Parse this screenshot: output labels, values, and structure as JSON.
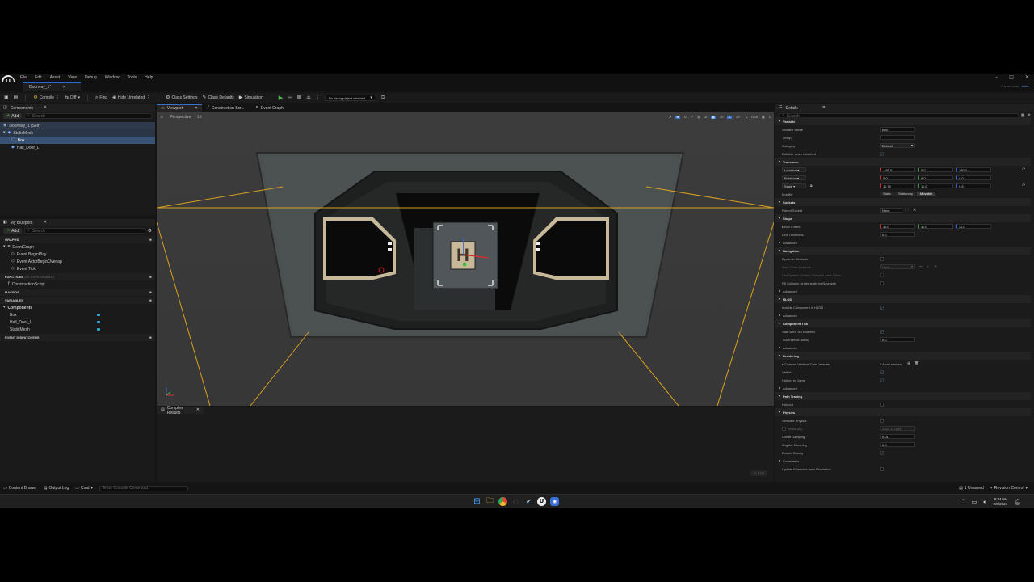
{
  "menubar": {
    "items": [
      "File",
      "Edit",
      "Asset",
      "View",
      "Debug",
      "Window",
      "Tools",
      "Help"
    ],
    "parent_class_label": "Parent class:",
    "parent_class_value": "Actor"
  },
  "tab": {
    "label": "Doorway_1*"
  },
  "toolbar": {
    "compile": "Compile",
    "diff": "Diff",
    "find": "Find",
    "hide_unrelated": "Hide Unrelated",
    "class_settings": "Class Settings",
    "class_defaults": "Class Defaults",
    "simulation": "Simulation",
    "debug_object": "No debug object selected"
  },
  "components": {
    "title": "Components",
    "add": "Add",
    "search_placeholder": "Search",
    "tree": [
      "Doorway_1 (Self)",
      "StaticMesh",
      "Box",
      "Hall_Door_L"
    ]
  },
  "my_blueprint": {
    "title": "My Blueprint",
    "add": "Add",
    "search_placeholder": "Search",
    "graphs_header": "GRAPHS",
    "event_graph": "EventGraph",
    "events": [
      "Event BeginPlay",
      "Event ActorBeginOverlap",
      "Event Tick"
    ],
    "functions_header": "FUNCTIONS",
    "functions_count": "(19 OVERRIDABLE)",
    "functions": [
      "ConstructionScript"
    ],
    "macros_header": "MACROS",
    "variables_header": "VARIABLES",
    "components_group": "Components",
    "variables": [
      "Box",
      "Hall_Door_L",
      "StaticMesh"
    ],
    "dispatchers_header": "EVENT DISPATCHERS"
  },
  "editor_tabs": [
    "Viewport",
    "Construction Scr...",
    "Event Graph"
  ],
  "viewport": {
    "perspective": "Perspective",
    "lit": "Lit",
    "grid_snap": "10",
    "rot_snap": "10°",
    "scale_snap": "0.25",
    "camera_speed": "1"
  },
  "compiler": {
    "title": "Compiler Results",
    "clear": "CLEAR"
  },
  "details": {
    "title": "Details",
    "search_placeholder": "Search",
    "variable_section": "Variable",
    "variable_name_label": "Variable Name",
    "variable_name": "Box",
    "tooltip_label": "Tooltip",
    "category_label": "Category",
    "category_value": "Default",
    "editable_label": "Editable when Inherited",
    "transform_section": "Transform",
    "location_label": "Location",
    "location": [
      "-480.0",
      "0.0",
      "180.0"
    ],
    "rotation_label": "Rotation",
    "rotation": [
      "0.0 °",
      "0.0 °",
      "0.0 °"
    ],
    "scale_label": "Scale",
    "scale": [
      "11.75",
      "11.0",
      "9.5"
    ],
    "mobility_label": "Mobility",
    "mobility": [
      "Static",
      "Stationary",
      "Movable"
    ],
    "sockets_section": "Sockets",
    "parent_socket_label": "Parent Socket",
    "parent_socket_value": "None",
    "shape_section": "Shape",
    "box_extent_label": "Box Extent",
    "box_extent": [
      "32.0",
      "32.0",
      "32.0"
    ],
    "line_thickness_label": "Line Thickness",
    "line_thickness": "0.0",
    "advanced": "Advanced",
    "navigation_section": "Navigation",
    "dynamic_obstacle_label": "Dynamic Obstacle",
    "area_class_override_label": "Area Class Override",
    "area_class_override_value": "None",
    "use_system_default_label": "Use System Default Obstacle Area Class",
    "fill_collision_label": "Fill Collision Underneath for Navmesh",
    "hlod_section": "HLOD",
    "include_hlod_label": "Include Component in HLOD",
    "component_tick_section": "Component Tick",
    "start_tick_label": "Start with Tick Enabled",
    "tick_interval_label": "Tick Interval (secs)",
    "tick_interval": "0.0",
    "rendering_section": "Rendering",
    "custom_primitive_label": "Custom Primitive Data Defaults",
    "custom_primitive_value": "0 Array element",
    "visible_label": "Visible",
    "hidden_in_game_label": "Hidden in Game",
    "path_tracing_section": "Path Tracing",
    "holdout_label": "Holdout",
    "physics_section": "Physics",
    "simulate_physics_label": "Simulate Physics",
    "mass_label": "Mass (kg)",
    "mass_value": "3963.127684",
    "linear_damping_label": "Linear Damping",
    "linear_damping": "0.01",
    "angular_damping_label": "Angular Damping",
    "angular_damping": "0.0",
    "enable_gravity_label": "Enable Gravity",
    "constraints_label": "Constraints",
    "update_kinematic_label": "Update Kinematic from Simulation"
  },
  "statusbar": {
    "content_drawer": "Content Drawer",
    "output_log": "Output Log",
    "cmd": "Cmd",
    "console_placeholder": "Enter Console Command",
    "unsaved": "1 Unsaved",
    "revision_control": "Revision Control"
  },
  "taskbar": {
    "time": "9:34 AM",
    "date": "2/8/2024"
  }
}
